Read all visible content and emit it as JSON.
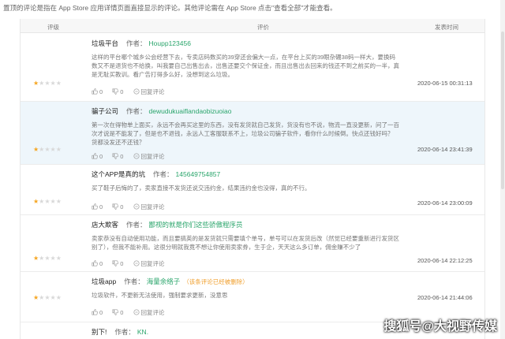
{
  "notice": "置顶的评论是指在 App Store 应用详情页面直接显示的评论。其他评论需在 App Store 点击\"查看全部\"才能查看。",
  "columns": {
    "rating": "评级",
    "review": "评价",
    "time": "发表时间"
  },
  "author_label": "作者：",
  "reviews": [
    {
      "stars": 1,
      "title": "垃圾平台",
      "author": "Houpp123456",
      "badge": "",
      "body": "这样的平台哪个城乡公会经营下去，专卖店码数买的39穿还会偏大一点，在平台上买的39眼杂硼38码一样大，要换码数又不是退货也不给换，叫我要自己出售出去，出售还要交个保证金，而且出售出去回来的钱还不到之前买的一半，真是无耻买教训。看广告打得多么好，没想到这么垃圾。",
      "likes": "0",
      "dislikes": "0",
      "reply": "回复评论",
      "time": "2020-06-15 00:31:13",
      "highlight": false
    },
    {
      "stars": 1,
      "title": "骗子公司",
      "author": "dewudukuaiflandaobizuoiao",
      "badge": "",
      "body": "第一次在得物单上面买，永远不会再买这里的东西，没有发货就自己发货，货没有也不说，物流一直没更新，问了一百次才说是不能发了，但是也不退钱，永远人工客服联系不上，垃圾公司骗子软件，看你什么时候倒。快点还钱好吗？ 货都没发还不还钱？",
      "likes": "0",
      "dislikes": "0",
      "reply": "回复评论",
      "time": "2020-06-14 23:41:39",
      "highlight": true
    },
    {
      "stars": 1,
      "title": "这个APP是真的坑",
      "author": "145649754857",
      "badge": "",
      "body": "买了鞋子后悔的了，卖家直接不发货还说交违约金，结果违约金也没得，真的不行。",
      "likes": "0",
      "dislikes": "0",
      "reply": "回复评论",
      "time": "2020-06-14 23:00:09",
      "highlight": false
    },
    {
      "stars": 1,
      "title": "店大欺客",
      "author": "鄙视的就是你们这些骄傲程序员",
      "badge": "",
      "body": "卖家恭没有自动使用功能，而且要搞英的是发货就只需要填个单号，单号可以在发货后改（然觉已经要重新进行发货区别了），但我不能补用。这很分明就我竟不想让你使用卖家券，生于企，天天这么多订单，佣金赚不少了",
      "likes": "0",
      "dislikes": "0",
      "reply": "回复评论",
      "time": "2020-06-14 22:12:25",
      "highlight": false
    },
    {
      "stars": 1,
      "title": "垃圾app",
      "author": "海量余络子",
      "badge": "（该条评论已经被删除）",
      "body": "垃圾软件，不更新无法使用，强制要求更新，没意思",
      "likes": "0",
      "dislikes": "0",
      "reply": "回复评论",
      "time": "2020-06-14 21:44:06",
      "highlight": false
    },
    {
      "stars": 1,
      "title": "别下!",
      "author": "KN.",
      "badge": "",
      "body": "",
      "likes": "",
      "dislikes": "",
      "reply": "",
      "time": "",
      "highlight": false
    }
  ],
  "watermark": "搜狐号@大视野传媒"
}
